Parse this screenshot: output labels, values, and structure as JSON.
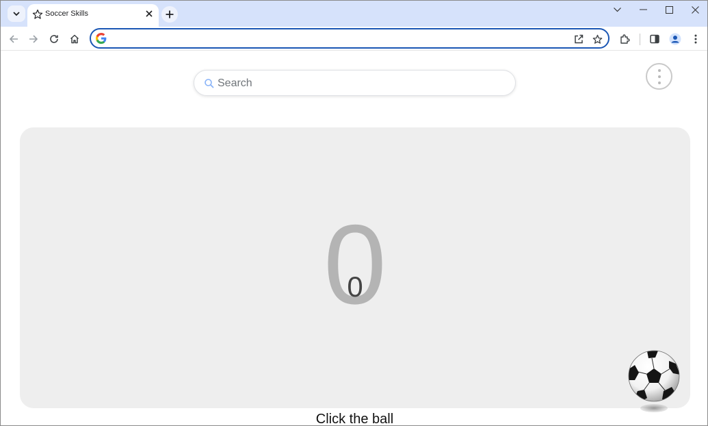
{
  "browser": {
    "tab_title": "Soccer Skills",
    "omnibox_value": ""
  },
  "page": {
    "search_placeholder": "Search",
    "score_big": "0",
    "score_small": "0",
    "instruction": "Click the ball"
  },
  "colors": {
    "tabstrip_bg": "#d6e2fb",
    "omnibox_border": "#1a56b4",
    "play_area_bg": "#eeeeee",
    "big_score": "#b4b4b4"
  },
  "icons": [
    "tab-search-icon",
    "star-icon",
    "close-icon",
    "plus-icon",
    "chevron-down-icon",
    "minimize-icon",
    "maximize-icon",
    "window-close-icon",
    "back-arrow-icon",
    "forward-arrow-icon",
    "reload-icon",
    "home-icon",
    "google-g-icon",
    "share-icon",
    "bookmark-star-icon",
    "extensions-icon",
    "side-panel-icon",
    "profile-icon",
    "menu-dots-icon",
    "search-icon",
    "soccer-ball-icon"
  ]
}
